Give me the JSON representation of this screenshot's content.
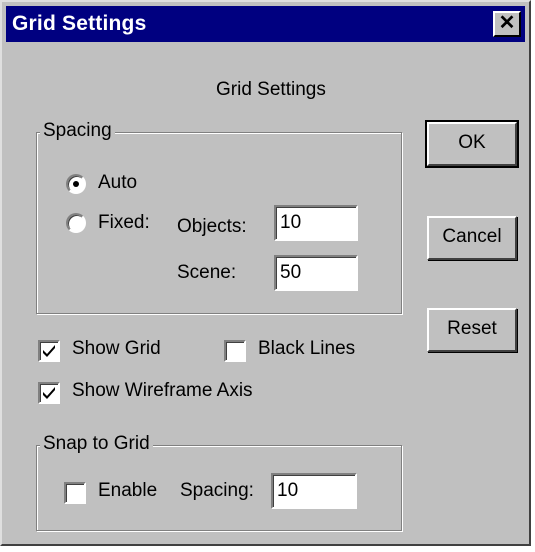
{
  "window": {
    "title": "Grid Settings",
    "close_glyph": "✕",
    "heading": "Grid Settings"
  },
  "buttons": {
    "ok": "OK",
    "cancel": "Cancel",
    "reset": "Reset"
  },
  "spacing": {
    "legend": "Spacing",
    "auto_label": "Auto",
    "auto_selected": true,
    "fixed_label": "Fixed:",
    "fixed_selected": false,
    "objects_label": "Objects:",
    "objects_value": "10",
    "scene_label": "Scene:",
    "scene_value": "50"
  },
  "options": {
    "show_grid_label": "Show Grid",
    "show_grid_checked": true,
    "black_lines_label": "Black Lines",
    "black_lines_checked": false,
    "show_axis_label": "Show Wireframe Axis",
    "show_axis_checked": true
  },
  "snap": {
    "legend": "Snap to Grid",
    "enable_label": "Enable",
    "enable_checked": false,
    "spacing_label": "Spacing:",
    "spacing_value": "10"
  }
}
